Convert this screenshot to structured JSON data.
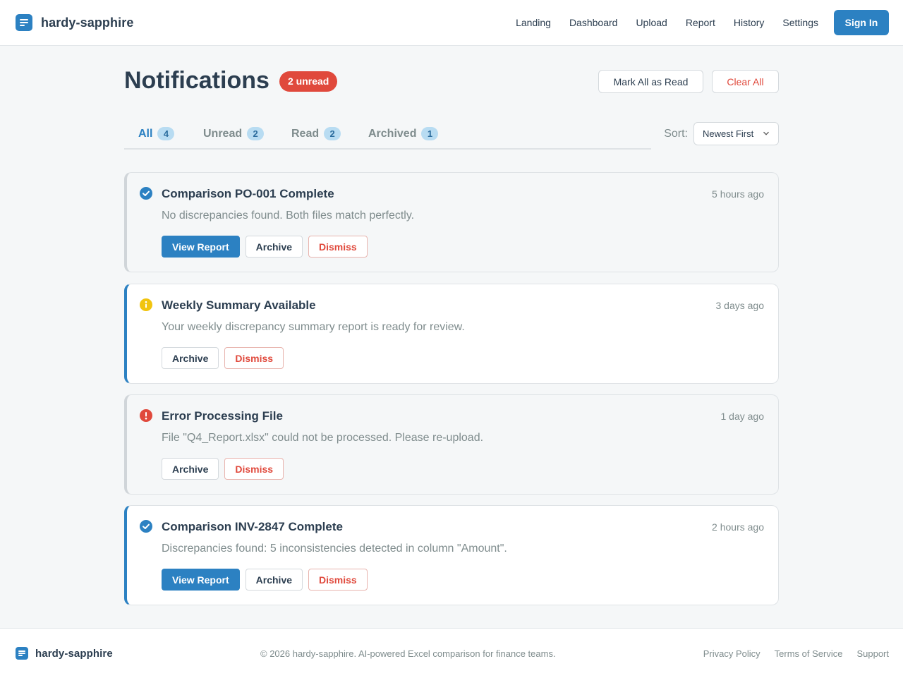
{
  "brand": {
    "name": "hardy-sapphire",
    "icon": "document-lines-icon",
    "color": "#2c81c2"
  },
  "nav": {
    "items": [
      "Landing",
      "Dashboard",
      "Upload",
      "Report",
      "History",
      "Settings"
    ],
    "sign_in": "Sign In"
  },
  "page": {
    "title": "Notifications",
    "unread_badge": "2 unread",
    "mark_all_read": "Mark All as Read",
    "clear_all": "Clear All"
  },
  "tabs": [
    {
      "label": "All",
      "count": "4",
      "active": true
    },
    {
      "label": "Unread",
      "count": "2",
      "active": false
    },
    {
      "label": "Read",
      "count": "2",
      "active": false
    },
    {
      "label": "Archived",
      "count": "1",
      "active": false
    }
  ],
  "sort": {
    "label": "Sort:",
    "selected": "Newest First"
  },
  "notifications": [
    {
      "icon": "check-circle-icon",
      "status": "success",
      "read": true,
      "title": "Comparison PO-001 Complete",
      "time": "5 hours ago",
      "message": "No discrepancies found. Both files match perfectly.",
      "actions": [
        "View Report",
        "Archive",
        "Dismiss"
      ]
    },
    {
      "icon": "info-circle-icon",
      "status": "info",
      "read": false,
      "title": "Weekly Summary Available",
      "time": "3 days ago",
      "message": "Your weekly discrepancy summary report is ready for review.",
      "actions": [
        "Archive",
        "Dismiss"
      ]
    },
    {
      "icon": "error-circle-icon",
      "status": "error",
      "read": true,
      "title": "Error Processing File",
      "time": "1 day ago",
      "message": "File \"Q4_Report.xlsx\" could not be processed. Please re-upload.",
      "actions": [
        "Archive",
        "Dismiss"
      ]
    },
    {
      "icon": "check-circle-icon",
      "status": "success",
      "read": false,
      "title": "Comparison INV-2847 Complete",
      "time": "2 hours ago",
      "message": "Discrepancies found: 5 inconsistencies detected in column \"Amount\".",
      "actions": [
        "View Report",
        "Archive",
        "Dismiss"
      ]
    }
  ],
  "footer": {
    "copyright": "© 2026 hardy-sapphire. AI-powered Excel comparison for finance teams.",
    "links": [
      "Privacy Policy",
      "Terms of Service",
      "Support"
    ]
  },
  "colors": {
    "accent": "#2c81c2",
    "danger": "#e0493c",
    "warning": "#f1c40f",
    "text": "#2c3e50",
    "muted": "#7f8c8d"
  }
}
